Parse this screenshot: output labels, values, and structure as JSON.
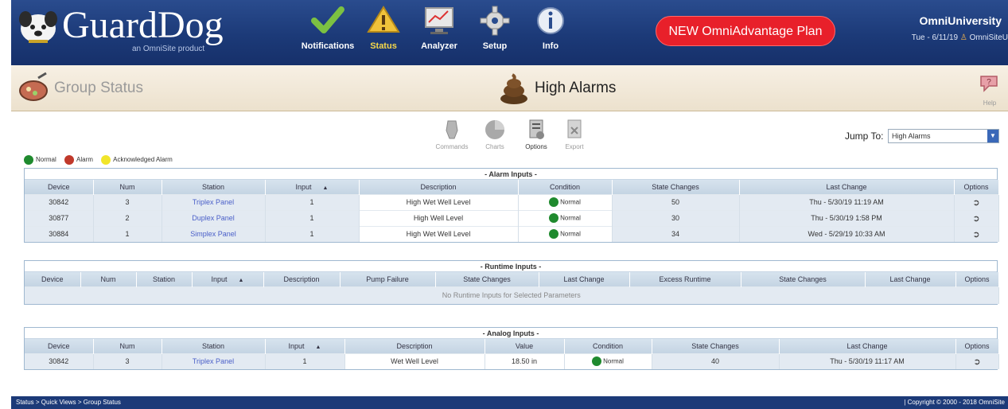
{
  "header": {
    "logo_name": "GuardDog",
    "logo_sub": "an OmniSite product",
    "nav": [
      {
        "label": "Notifications",
        "icon": "checkmark-icon"
      },
      {
        "label": "Status",
        "icon": "warning-bell-icon"
      },
      {
        "label": "Analyzer",
        "icon": "analyzer-monitor-icon"
      },
      {
        "label": "Setup",
        "icon": "gear-icon"
      },
      {
        "label": "Info",
        "icon": "info-icon"
      }
    ],
    "promo": "NEW OmniAdvantage Plan",
    "org": "OmniUniversity",
    "date": "Tue - 6/11/19",
    "user": "OmniSiteU"
  },
  "title": {
    "page": "Group Status",
    "alarm": "High Alarms",
    "help": "Help"
  },
  "toolbar": [
    "Commands",
    "Charts",
    "Options",
    "Export"
  ],
  "jump": {
    "label": "Jump To:",
    "value": "High Alarms"
  },
  "legend": [
    "Normal",
    "Alarm",
    "Acknowledged Alarm"
  ],
  "alarm_inputs": {
    "caption": "- Alarm Inputs -",
    "headers": [
      "Device",
      "Num",
      "Station",
      "Input",
      "Description",
      "Condition",
      "State Changes",
      "Last Change",
      "Options"
    ],
    "rows": [
      {
        "device": "30842",
        "num": "3",
        "station": "Triplex Panel",
        "input": "1",
        "description": "High Wet Well Level",
        "condition": "Normal",
        "changes": "50",
        "last": "Thu - 5/30/19 11:19 AM"
      },
      {
        "device": "30877",
        "num": "2",
        "station": "Duplex Panel",
        "input": "1",
        "description": "High Well Level",
        "condition": "Normal",
        "changes": "30",
        "last": "Thu - 5/30/19 1:58 PM"
      },
      {
        "device": "30884",
        "num": "1",
        "station": "Simplex Panel",
        "input": "1",
        "description": "High Wet Well Level",
        "condition": "Normal",
        "changes": "34",
        "last": "Wed - 5/29/19 10:33 AM"
      }
    ]
  },
  "runtime_inputs": {
    "caption": "- Runtime Inputs -",
    "headers": [
      "Device",
      "Num",
      "Station",
      "Input",
      "Description",
      "Pump Failure",
      "State Changes",
      "Last Change",
      "Excess Runtime",
      "State Changes",
      "Last Change",
      "Options"
    ],
    "empty": "No Runtime Inputs for Selected Parameters"
  },
  "analog_inputs": {
    "caption": "- Analog Inputs -",
    "headers": [
      "Device",
      "Num",
      "Station",
      "Input",
      "Description",
      "Value",
      "Condition",
      "State Changes",
      "Last Change",
      "Options"
    ],
    "rows": [
      {
        "device": "30842",
        "num": "3",
        "station": "Triplex Panel",
        "input": "1",
        "description": "Wet Well Level",
        "value": "18.50 in",
        "condition": "Normal",
        "changes": "40",
        "last": "Thu - 5/30/19 11:17 AM"
      }
    ]
  },
  "footer": {
    "breadcrumb": "Status > Quick Views > Group Status",
    "copyright": "| Copyright © 2000 - 2018 OmniSite"
  },
  "colors": {
    "normal": "#1f8a2e",
    "alarm": "#c0392b",
    "ack": "#f1e52a",
    "header_blue": "#1c3a78",
    "promo": "#e8202a"
  }
}
